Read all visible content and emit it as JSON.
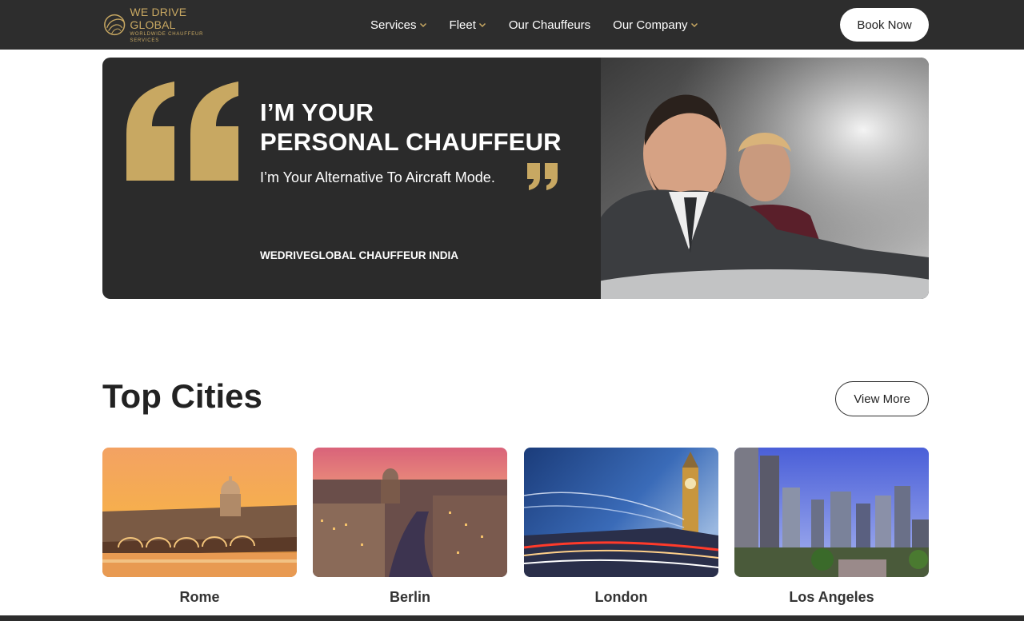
{
  "header": {
    "logo_name": "WE DRIVE GLOBAL",
    "logo_tagline": "WORLDWIDE CHAUFFEUR SERVICES",
    "nav": [
      {
        "label": "Services",
        "dropdown": true
      },
      {
        "label": "Fleet",
        "dropdown": true
      },
      {
        "label": "Our Chauffeurs",
        "dropdown": false
      },
      {
        "label": "Our Company",
        "dropdown": true
      }
    ],
    "cta_label": "Book Now"
  },
  "hero": {
    "title_line1": "I’M YOUR",
    "title_line2": "PERSONAL CHAUFFEUR",
    "subtitle": "I’m Your Alternative To Aircraft Mode.",
    "tagline": "WEDRIVEGLOBAL CHAUFFEUR INDIA",
    "quote_icon": "quote-icon",
    "photo": "chauffeur-driving-photo"
  },
  "top_cities": {
    "title": "Top Cities",
    "view_more_label": "View More",
    "cities": [
      {
        "name": "Rome",
        "image": "rome-photo"
      },
      {
        "name": "Berlin",
        "image": "berlin-photo"
      },
      {
        "name": "London",
        "image": "london-photo"
      },
      {
        "name": "Los Angeles",
        "image": "los-angeles-photo"
      }
    ]
  },
  "colors": {
    "header_bg": "#2d2d2d",
    "hero_bg": "#2b2b2b",
    "gold": "#c8a862",
    "white": "#ffffff"
  }
}
